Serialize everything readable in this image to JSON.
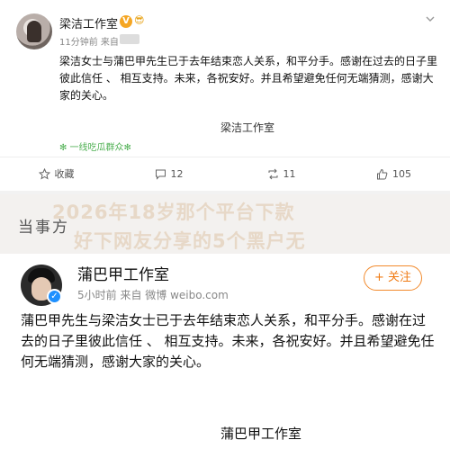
{
  "post1": {
    "author": "梁洁工作室",
    "verified_badge": "V",
    "emoji": "😎",
    "time": "11分钟前",
    "source_prefix": "来自",
    "body": "梁洁女士与蒲巴甲先生已于去年结束恋人关系，和平分手。感谢在过去的日子里彼此信任 、 相互支持。未来，各祝安好。并且希望避免任何无端猜测，感谢大家的关心。",
    "signature": "梁洁工作室",
    "tag": "✻ 一线吃瓜群众✻",
    "actions": {
      "favorite": "收藏",
      "comments": "12",
      "reposts": "11",
      "likes": "105"
    }
  },
  "watermark": {
    "line1": "2026年18岁那个平台下款",
    "line2": "好下网友分享的5个黑户无"
  },
  "section_title": "当事方",
  "post2": {
    "author": "蒲巴甲工作室",
    "verified_badge": "✓",
    "meta": "5小时前  来自 微博 weibo.com",
    "follow_label": "+ 关注",
    "body": "蒲巴甲先生与梁洁女士已于去年结束恋人关系，和平分手。感谢在过去的日子里彼此信任 、 相互支持。未来，各祝安好。并且希望避免任何无端猜测，感谢大家的关心。",
    "signature": "蒲巴甲工作室"
  },
  "colors": {
    "accent_orange": "#f07b14",
    "verified_blue": "#1e90ff",
    "verified_gold": "#f5a623",
    "tag_green": "#4caf50"
  }
}
